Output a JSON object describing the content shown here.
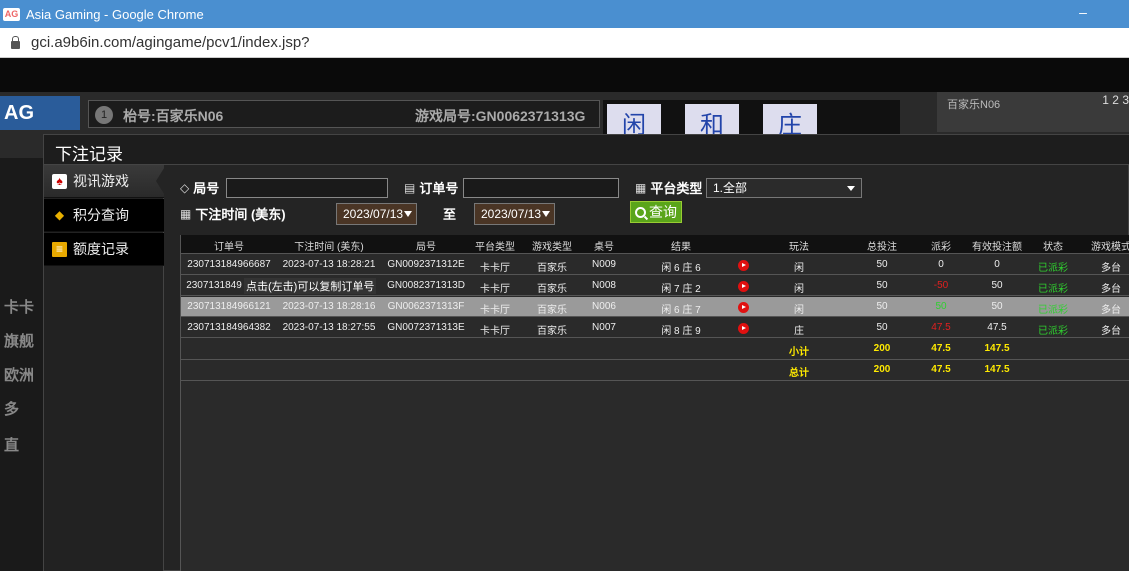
{
  "browser": {
    "title": "Asia Gaming - Google Chrome",
    "icon": "AG",
    "url": "gci.a9b6in.com/agingame/pcv1/index.jsp?",
    "minimize": "–"
  },
  "game": {
    "logo": "AG",
    "table_no": "1",
    "table_label": "枱号:百家乐N06",
    "round_label": "游戏局号:GN0062371313G",
    "bet_cards": [
      "闲",
      "和",
      "庄"
    ],
    "right_title": "百家乐N06",
    "right_nums": "1 2 3",
    "left_items": [
      "卡卡",
      "旗舰",
      "欧洲",
      "多",
      "直"
    ]
  },
  "modal": {
    "title": "下注记录",
    "sidebar": [
      {
        "label": "视讯游戏",
        "icon": "cards-icon"
      },
      {
        "label": "积分查询",
        "icon": "diamond-icon"
      },
      {
        "label": "额度记录",
        "icon": "document-icon"
      }
    ],
    "filters": {
      "round_label": "局号",
      "round_value": "",
      "order_label": "订单号",
      "order_value": "",
      "platform_label": "平台类型",
      "platform_value": "1.全部",
      "time_label": "下注时间 (美东)",
      "date_from": "2023/07/13",
      "to_label": "至",
      "date_to": "2023/07/13",
      "query_label": "查询"
    },
    "table": {
      "headers": [
        "订单号",
        "下注时间 (美东)",
        "局号",
        "平台类型",
        "游戏类型",
        "桌号",
        "结果",
        "",
        "玩法",
        "总投注",
        "派彩",
        "有效投注额",
        "状态",
        "游戏模式"
      ],
      "rows": [
        {
          "order": "230713184966687",
          "time": "2023-07-13 18:28:21",
          "round": "GN0092371312E",
          "platform": "卡卡厅",
          "game": "百家乐",
          "table": "N009",
          "result": "闲 6 庄 6",
          "play": "闲",
          "bet": "50",
          "payout": "0",
          "valid": "0",
          "status": "已派彩",
          "mode": "多台"
        },
        {
          "order": "2307131849",
          "time": "",
          "round": "GN0082371313D",
          "platform": "卡卡厅",
          "game": "百家乐",
          "table": "N008",
          "result": "闲 7 庄 2",
          "play": "闲",
          "bet": "50",
          "payout": "-50",
          "valid": "50",
          "status": "已派彩",
          "mode": "多台"
        },
        {
          "order": "230713184966121",
          "time": "2023-07-13 18:28:16",
          "round": "GN0062371313F",
          "platform": "卡卡厅",
          "game": "百家乐",
          "table": "N006",
          "result": "闲 6 庄 7",
          "play": "闲",
          "bet": "50",
          "payout": "50",
          "valid": "50",
          "status": "已派彩",
          "mode": "多台"
        },
        {
          "order": "230713184964382",
          "time": "2023-07-13 18:27:55",
          "round": "GN0072371313E",
          "platform": "卡卡厅",
          "game": "百家乐",
          "table": "N007",
          "result": "闲 8 庄 9",
          "play": "庄",
          "bet": "50",
          "payout": "47.5",
          "valid": "47.5",
          "status": "已派彩",
          "mode": "多台"
        }
      ],
      "tooltip": "点击(左击)可以复制订单号",
      "subtotal": {
        "label": "小计",
        "bet": "200",
        "payout": "47.5",
        "valid": "147.5"
      },
      "total": {
        "label": "总计",
        "bet": "200",
        "payout": "47.5",
        "valid": "147.5"
      }
    }
  },
  "colors": {
    "accent_green": "#5aa51a",
    "status_green": "#2fd02f",
    "loss_red": "#e02020",
    "sum_yellow": "#ffea00"
  }
}
